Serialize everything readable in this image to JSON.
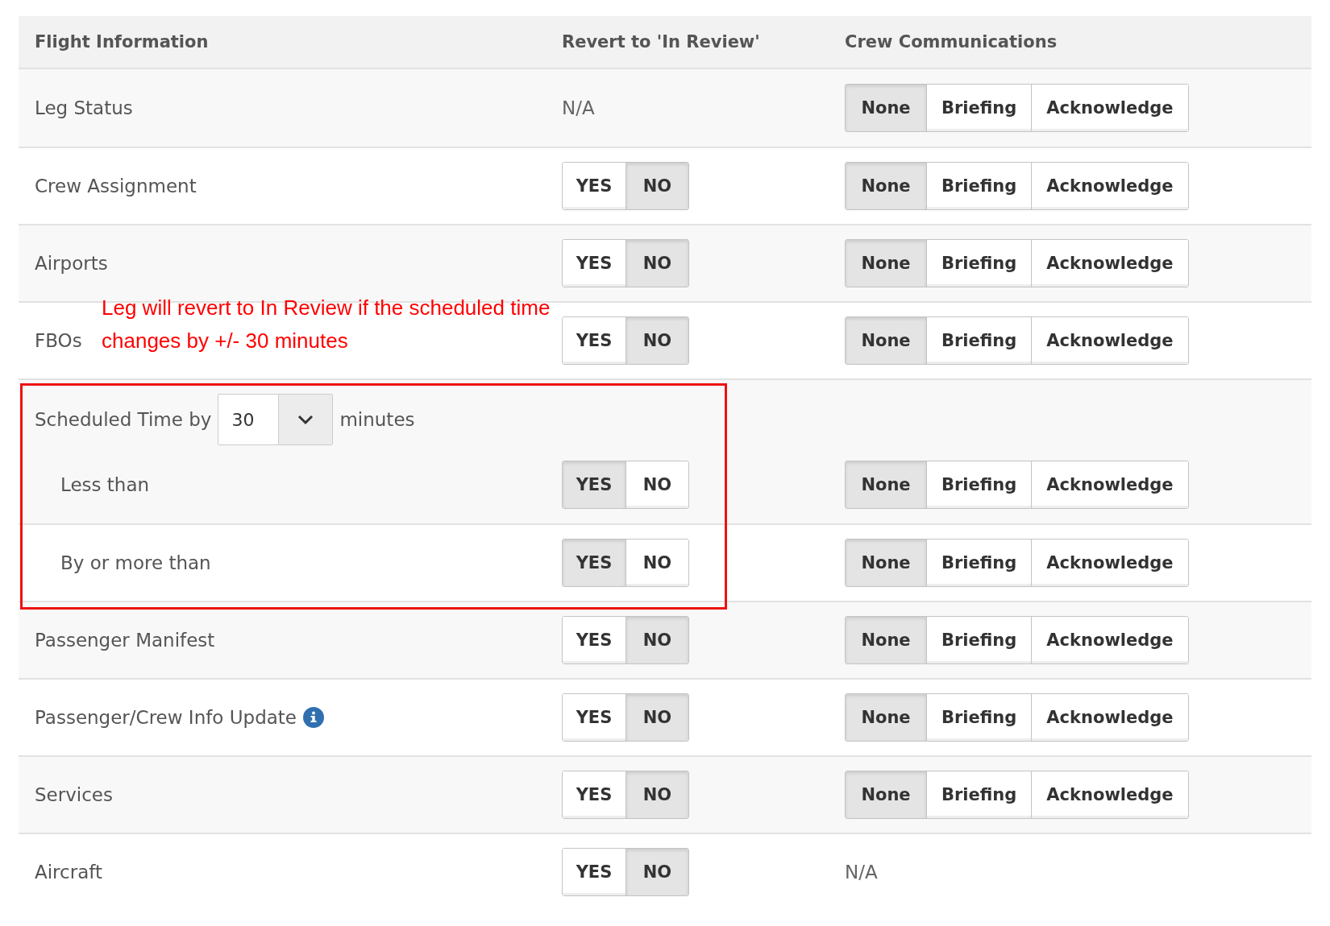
{
  "table": {
    "columns": [
      "Flight Information",
      "Revert to 'In Review'",
      "Crew Communications"
    ],
    "rows": [
      {
        "kind": "plain",
        "label": "Leg Status",
        "info": false,
        "revert": {
          "text": "N/A"
        },
        "crew": {
          "options": [
            {
              "label": "None",
              "selected": true
            },
            {
              "label": "Briefing",
              "selected": false
            },
            {
              "label": "Acknowledge",
              "selected": false
            }
          ]
        }
      },
      {
        "kind": "plain",
        "label": "Crew Assignment",
        "info": false,
        "revert": {
          "options": [
            {
              "label": "YES",
              "selected": false
            },
            {
              "label": "NO",
              "selected": true
            }
          ]
        },
        "crew": {
          "options": [
            {
              "label": "None",
              "selected": true
            },
            {
              "label": "Briefing",
              "selected": false
            },
            {
              "label": "Acknowledge",
              "selected": false
            }
          ]
        }
      },
      {
        "kind": "plain",
        "label": "Airports",
        "info": false,
        "revert": {
          "options": [
            {
              "label": "YES",
              "selected": false
            },
            {
              "label": "NO",
              "selected": true
            }
          ]
        },
        "crew": {
          "options": [
            {
              "label": "None",
              "selected": true
            },
            {
              "label": "Briefing",
              "selected": false
            },
            {
              "label": "Acknowledge",
              "selected": false
            }
          ]
        }
      },
      {
        "kind": "plain",
        "label": "FBOs",
        "info": false,
        "revert": {
          "options": [
            {
              "label": "YES",
              "selected": false
            },
            {
              "label": "NO",
              "selected": true
            }
          ]
        },
        "crew": {
          "options": [
            {
              "label": "None",
              "selected": true
            },
            {
              "label": "Briefing",
              "selected": false
            },
            {
              "label": "Acknowledge",
              "selected": false
            }
          ]
        }
      },
      {
        "kind": "scheduled",
        "label": "Scheduled Time by",
        "value": "30",
        "unit": "minutes",
        "sub": {
          "label": "Less than",
          "revert": {
            "options": [
              {
                "label": "YES",
                "selected": true
              },
              {
                "label": "NO",
                "selected": false
              }
            ]
          },
          "crew": {
            "options": [
              {
                "label": "None",
                "selected": true
              },
              {
                "label": "Briefing",
                "selected": false
              },
              {
                "label": "Acknowledge",
                "selected": false
              }
            ]
          }
        }
      },
      {
        "kind": "sub",
        "label": "By or more than",
        "info": false,
        "revert": {
          "options": [
            {
              "label": "YES",
              "selected": true
            },
            {
              "label": "NO",
              "selected": false
            }
          ]
        },
        "crew": {
          "options": [
            {
              "label": "None",
              "selected": true
            },
            {
              "label": "Briefing",
              "selected": false
            },
            {
              "label": "Acknowledge",
              "selected": false
            }
          ]
        }
      },
      {
        "kind": "plain",
        "label": "Passenger Manifest",
        "info": false,
        "revert": {
          "options": [
            {
              "label": "YES",
              "selected": false
            },
            {
              "label": "NO",
              "selected": true
            }
          ]
        },
        "crew": {
          "options": [
            {
              "label": "None",
              "selected": true
            },
            {
              "label": "Briefing",
              "selected": false
            },
            {
              "label": "Acknowledge",
              "selected": false
            }
          ]
        }
      },
      {
        "kind": "plain",
        "label": "Passenger/Crew Info Update",
        "info": true,
        "revert": {
          "options": [
            {
              "label": "YES",
              "selected": false
            },
            {
              "label": "NO",
              "selected": true
            }
          ]
        },
        "crew": {
          "options": [
            {
              "label": "None",
              "selected": true
            },
            {
              "label": "Briefing",
              "selected": false
            },
            {
              "label": "Acknowledge",
              "selected": false
            }
          ]
        }
      },
      {
        "kind": "plain",
        "label": "Services",
        "info": false,
        "revert": {
          "options": [
            {
              "label": "YES",
              "selected": false
            },
            {
              "label": "NO",
              "selected": true
            }
          ]
        },
        "crew": {
          "options": [
            {
              "label": "None",
              "selected": true
            },
            {
              "label": "Briefing",
              "selected": false
            },
            {
              "label": "Acknowledge",
              "selected": false
            }
          ]
        }
      },
      {
        "kind": "plain",
        "label": "Aircraft",
        "info": false,
        "revert": {
          "options": [
            {
              "label": "YES",
              "selected": false
            },
            {
              "label": "NO",
              "selected": true
            }
          ]
        },
        "crew": {
          "text": "N/A"
        }
      }
    ]
  },
  "annotation": {
    "note": "Leg will revert to In Review if the scheduled time changes by +/- 30 minutes",
    "highlight_frame": true
  }
}
